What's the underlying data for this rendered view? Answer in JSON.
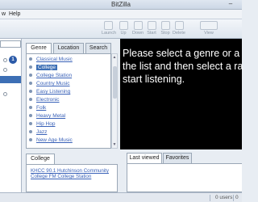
{
  "window": {
    "title": "BitZilla",
    "minimize_icon": "minimize-icon"
  },
  "menu": {
    "items": [
      "w",
      "Help"
    ]
  },
  "toolbar": {
    "buttons": [
      "Launch",
      "Up",
      "Down",
      "Start",
      "Stop",
      "Delete",
      "View"
    ]
  },
  "sidebar": {
    "badge": "1"
  },
  "genre_panel": {
    "tabs": [
      "Genre",
      "Location",
      "Search"
    ],
    "active_tab": "Genre",
    "items": [
      "Classical Music",
      "College",
      "College Station",
      "Country Music",
      "Easy Listening",
      "Electronic",
      "Folk",
      "Heavy Metal",
      "Hip Hop",
      "Jazz",
      "New Age Music"
    ],
    "selected_item": "College"
  },
  "station_panel": {
    "tab": "College",
    "stations": [
      "KHCC 90.1 Hutchinson Community College FM College Station"
    ]
  },
  "player": {
    "message": "Please select a genre or a\nthe list and then select a ra\nstart listening."
  },
  "bottom_panel": {
    "tabs": [
      "Last viewed",
      "Favorites"
    ],
    "active_tab": "Last viewed"
  },
  "status": {
    "users": "0 users",
    "extra": "0"
  },
  "colors": {
    "selection": "#3d6fb5",
    "link": "#3a62b8",
    "player_bg": "#000000"
  }
}
